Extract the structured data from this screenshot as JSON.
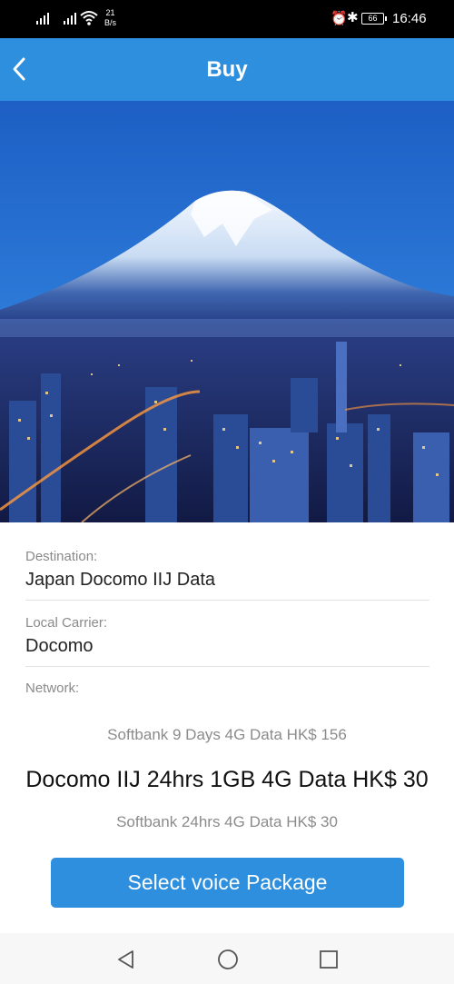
{
  "status_bar": {
    "speed_value": "21",
    "speed_unit": "B/s",
    "battery": "66",
    "time": "16:46"
  },
  "header": {
    "title": "Buy"
  },
  "details": {
    "destination_label": "Destination:",
    "destination_value": "Japan Docomo IIJ Data",
    "carrier_label": "Local Carrier:",
    "carrier_value": "Docomo",
    "network_label": "Network:"
  },
  "packages": {
    "options": [
      "Softbank 9 Days 4G Data HK$ 156",
      "Docomo IIJ 24hrs 1GB 4G Data HK$ 30",
      "Softbank 24hrs 4G Data HK$ 30"
    ],
    "selected_index": 1
  },
  "actions": {
    "select_voice_label": "Select voice Package"
  },
  "colors": {
    "accent": "#2d8fdd",
    "status_bar": "#000000",
    "nav_bar": "#f7f7f7"
  }
}
